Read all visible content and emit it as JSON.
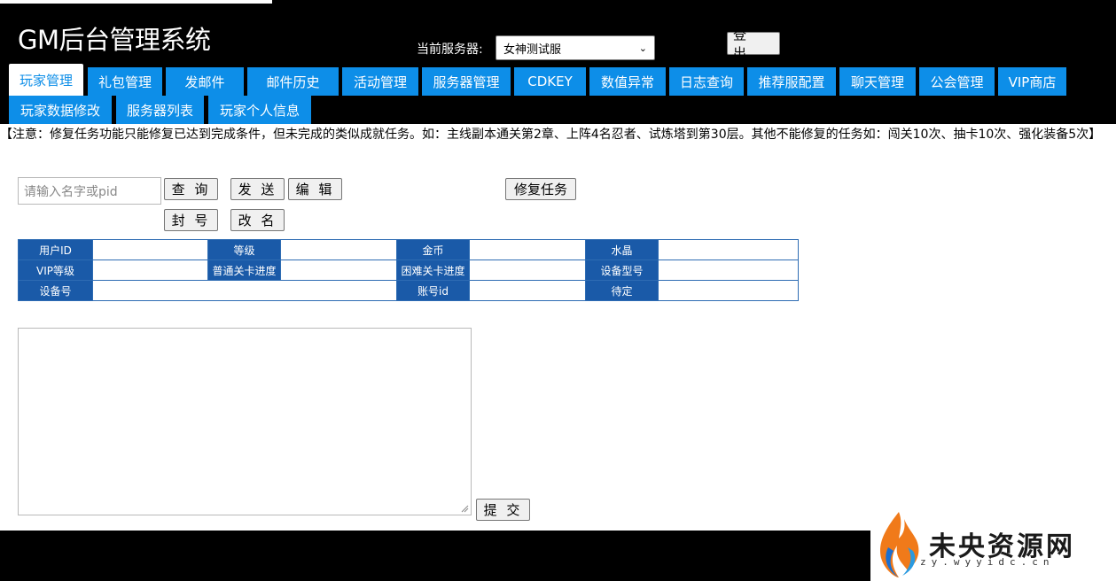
{
  "header": {
    "title": "GM后台管理系统",
    "server_label": "当前服务器:",
    "server_selected": "女神测试服",
    "logout_label": "登 出"
  },
  "tabs": [
    {
      "label": "玩家管理",
      "active": true
    },
    {
      "label": "礼包管理"
    },
    {
      "label": "发邮件"
    },
    {
      "label": "邮件历史"
    },
    {
      "label": "活动管理"
    },
    {
      "label": "服务器管理"
    },
    {
      "label": "CDKEY"
    },
    {
      "label": "数值异常"
    },
    {
      "label": "日志查询"
    },
    {
      "label": "推荐服配置"
    },
    {
      "label": "聊天管理"
    },
    {
      "label": "公会管理"
    },
    {
      "label": "VIP商店"
    },
    {
      "label": "玩家数据修改"
    },
    {
      "label": "服务器列表"
    },
    {
      "label": "玩家个人信息"
    }
  ],
  "notice": "【注意：修复任务功能只能修复已达到完成条件，但未完成的类似成就任务。如：主线副本通关第2章、上阵4名忍者、试炼塔到第30层。其他不能修复的任务如：闯关10次、抽卡10次、强化装备5次】",
  "search": {
    "placeholder": "请输入名字或pid",
    "value": ""
  },
  "actions": {
    "query": "查 询",
    "send": "发 送",
    "edit": "编 辑",
    "repair_task": "修复任务",
    "ban": "封 号",
    "rename": "改 名",
    "submit": "提 交"
  },
  "info_table": {
    "rows": [
      [
        {
          "label": "用户ID",
          "value": ""
        },
        {
          "label": "等级",
          "value": ""
        },
        {
          "label": "金币",
          "value": ""
        },
        {
          "label": "水晶",
          "value": ""
        }
      ],
      [
        {
          "label": "VIP等级",
          "value": ""
        },
        {
          "label": "普通关卡进度",
          "value": ""
        },
        {
          "label": "困难关卡进度",
          "value": ""
        },
        {
          "label": "设备型号",
          "value": ""
        }
      ],
      [
        {
          "label": "设备号",
          "value": ""
        },
        {
          "label": "账号id",
          "value": ""
        },
        {
          "label": "待定",
          "value": ""
        }
      ]
    ]
  },
  "editor": {
    "value": ""
  },
  "watermark": {
    "main": "未央资源网",
    "sub": "zy.wyyidc.cn"
  }
}
